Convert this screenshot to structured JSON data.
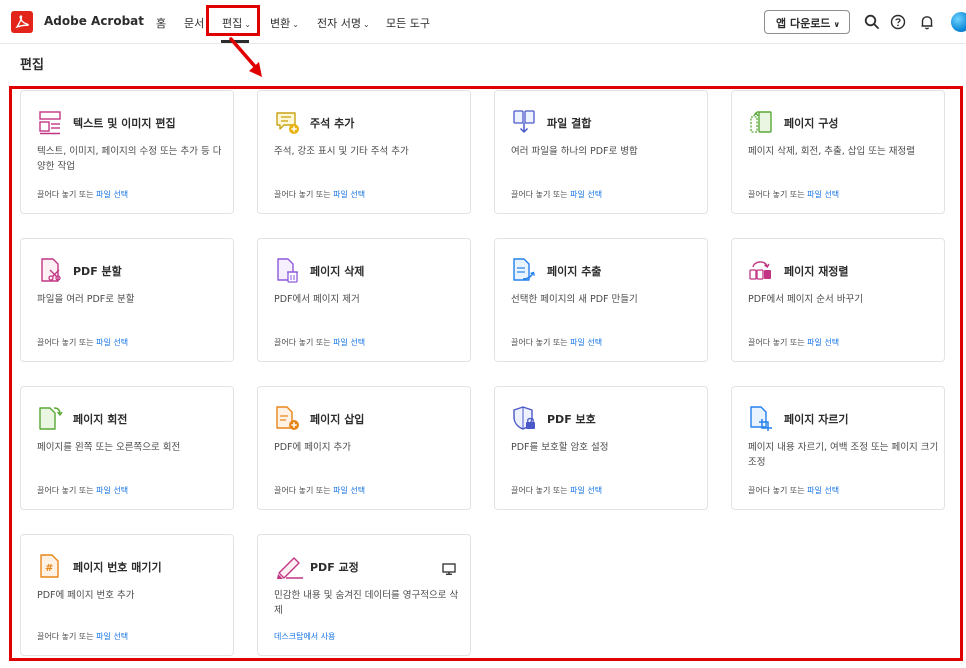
{
  "header": {
    "app_title": "Adobe Acrobat",
    "nav": [
      {
        "label": "홈",
        "has_menu": false
      },
      {
        "label": "문서",
        "has_menu": false
      },
      {
        "label": "편집",
        "has_menu": true,
        "active": true
      },
      {
        "label": "변환",
        "has_menu": true
      },
      {
        "label": "전자 서명",
        "has_menu": true
      },
      {
        "label": "모든 도구",
        "has_menu": false
      }
    ],
    "download_button": "앱 다운로드",
    "icons": [
      "search-icon",
      "help-icon",
      "notification-bell-icon",
      "user-avatar"
    ]
  },
  "page": {
    "title": "편집"
  },
  "footer_text": {
    "drag": "끌어다 놓기 또는",
    "select": "파일 선택"
  },
  "cards": [
    {
      "icon": "edit-text-image-icon",
      "title": "텍스트 및 이미지 편집",
      "desc": "텍스트, 이미지, 페이지의 수정 또는 추가 등 다양한 작업"
    },
    {
      "icon": "add-comment-icon",
      "title": "주석 추가",
      "desc": "주석, 강조 표시 및 기타 주석 추가"
    },
    {
      "icon": "combine-files-icon",
      "title": "파일 결합",
      "desc": "여러 파일을 하나의 PDF로 병합"
    },
    {
      "icon": "organize-pages-icon",
      "title": "페이지 구성",
      "desc": "페이지 삭제, 회전, 추출, 삽입 또는 재정렬"
    },
    {
      "icon": "split-pdf-icon",
      "title": "PDF 분할",
      "desc": "파일을 여러 PDF로 분할"
    },
    {
      "icon": "delete-pages-icon",
      "title": "페이지 삭제",
      "desc": "PDF에서 페이지 제거"
    },
    {
      "icon": "extract-pages-icon",
      "title": "페이지 추출",
      "desc": "선택한 페이지의 새 PDF 만들기"
    },
    {
      "icon": "reorder-pages-icon",
      "title": "페이지 재정렬",
      "desc": "PDF에서 페이지 순서 바꾸기"
    },
    {
      "icon": "rotate-pages-icon",
      "title": "페이지 회전",
      "desc": "페이지를 왼쪽 또는 오른쪽으로 회전"
    },
    {
      "icon": "insert-pages-icon",
      "title": "페이지 삽입",
      "desc": "PDF에 페이지 추가"
    },
    {
      "icon": "protect-pdf-icon",
      "title": "PDF 보호",
      "desc": "PDF를 보호할 암호 설정"
    },
    {
      "icon": "crop-pages-icon",
      "title": "페이지 자르기",
      "desc": "페이지 내용 자르기, 여백 조정 또는 페이지 크기 조정"
    },
    {
      "icon": "number-pages-icon",
      "title": "페이지 번호 매기기",
      "desc": "PDF에 페이지 번호 추가"
    },
    {
      "icon": "redact-pdf-icon",
      "title": "PDF 교정",
      "desc": "민감한 내용 및 숨겨진 데이터를 영구적으로 삭제",
      "footer_link": "데스크탑에서 사용",
      "desktop_only": true
    }
  ],
  "colors": {
    "accent_red": "#e00000",
    "acrobat_red": "#e3241b",
    "link_blue": "#1473e6"
  }
}
